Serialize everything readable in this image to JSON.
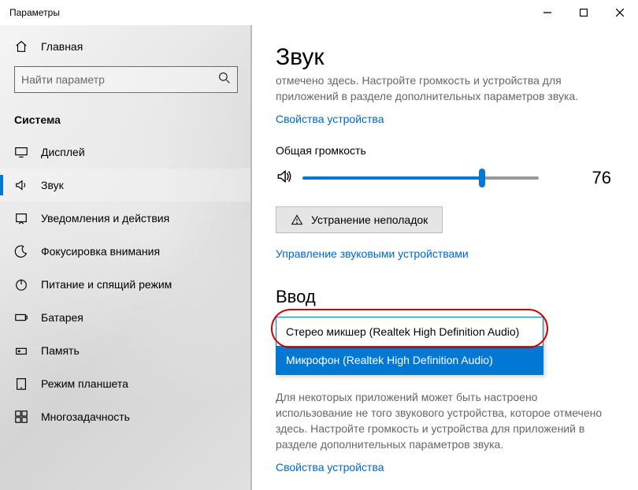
{
  "window": {
    "title": "Параметры"
  },
  "sidebar": {
    "home_label": "Главная",
    "search_placeholder": "Найти параметр",
    "section": "Система",
    "items": [
      {
        "label": "Дисплей"
      },
      {
        "label": "Звук"
      },
      {
        "label": "Уведомления и действия"
      },
      {
        "label": "Фокусировка внимания"
      },
      {
        "label": "Питание и спящий режим"
      },
      {
        "label": "Батарея"
      },
      {
        "label": "Память"
      },
      {
        "label": "Режим планшета"
      },
      {
        "label": "Многозадачность"
      }
    ]
  },
  "main": {
    "title": "Звук",
    "truncated_top": "отмечено здесь. Настройте громкость и устройства для приложений в разделе дополнительных параметров звука.",
    "props_link_top": "Свойства устройства",
    "volume_label": "Общая громкость",
    "volume_value": "76",
    "troubleshoot_label": "Устранение неполадок",
    "manage_link": "Управление звуковыми устройствами",
    "input_header": "Ввод",
    "dropdown": {
      "option1": "Стерео микшер (Realtek High Definition Audio)",
      "option2": "Микрофон (Realtek High Definition Audio)"
    },
    "desc_text": "Для некоторых приложений может быть настроено использование не того звукового устройства, которое отмечено здесь. Настройте громкость и устройства для приложений в разделе дополнительных параметров звука.",
    "props_link_bottom": "Свойства устройства"
  }
}
